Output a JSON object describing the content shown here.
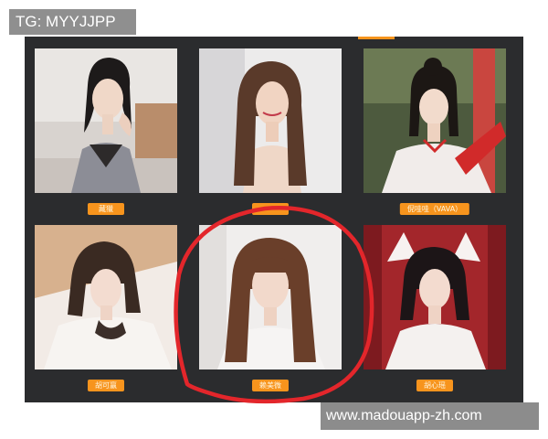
{
  "overlay": {
    "tg_label": "TG: MYYJJPP",
    "url_label": "www.madouapp-zh.com"
  },
  "grid": {
    "cards": [
      {
        "name_tag": "藏獵"
      },
      {
        "name_tag": ""
      },
      {
        "name_tag": "倪哇哇（VAVA）"
      },
      {
        "name_tag": "胡可赢"
      },
      {
        "name_tag": "赖美微"
      },
      {
        "name_tag": "胡心瑶"
      }
    ]
  },
  "colors": {
    "board": "#2b2c2e",
    "tag": "#f7941d",
    "circle": "#e3262b"
  }
}
